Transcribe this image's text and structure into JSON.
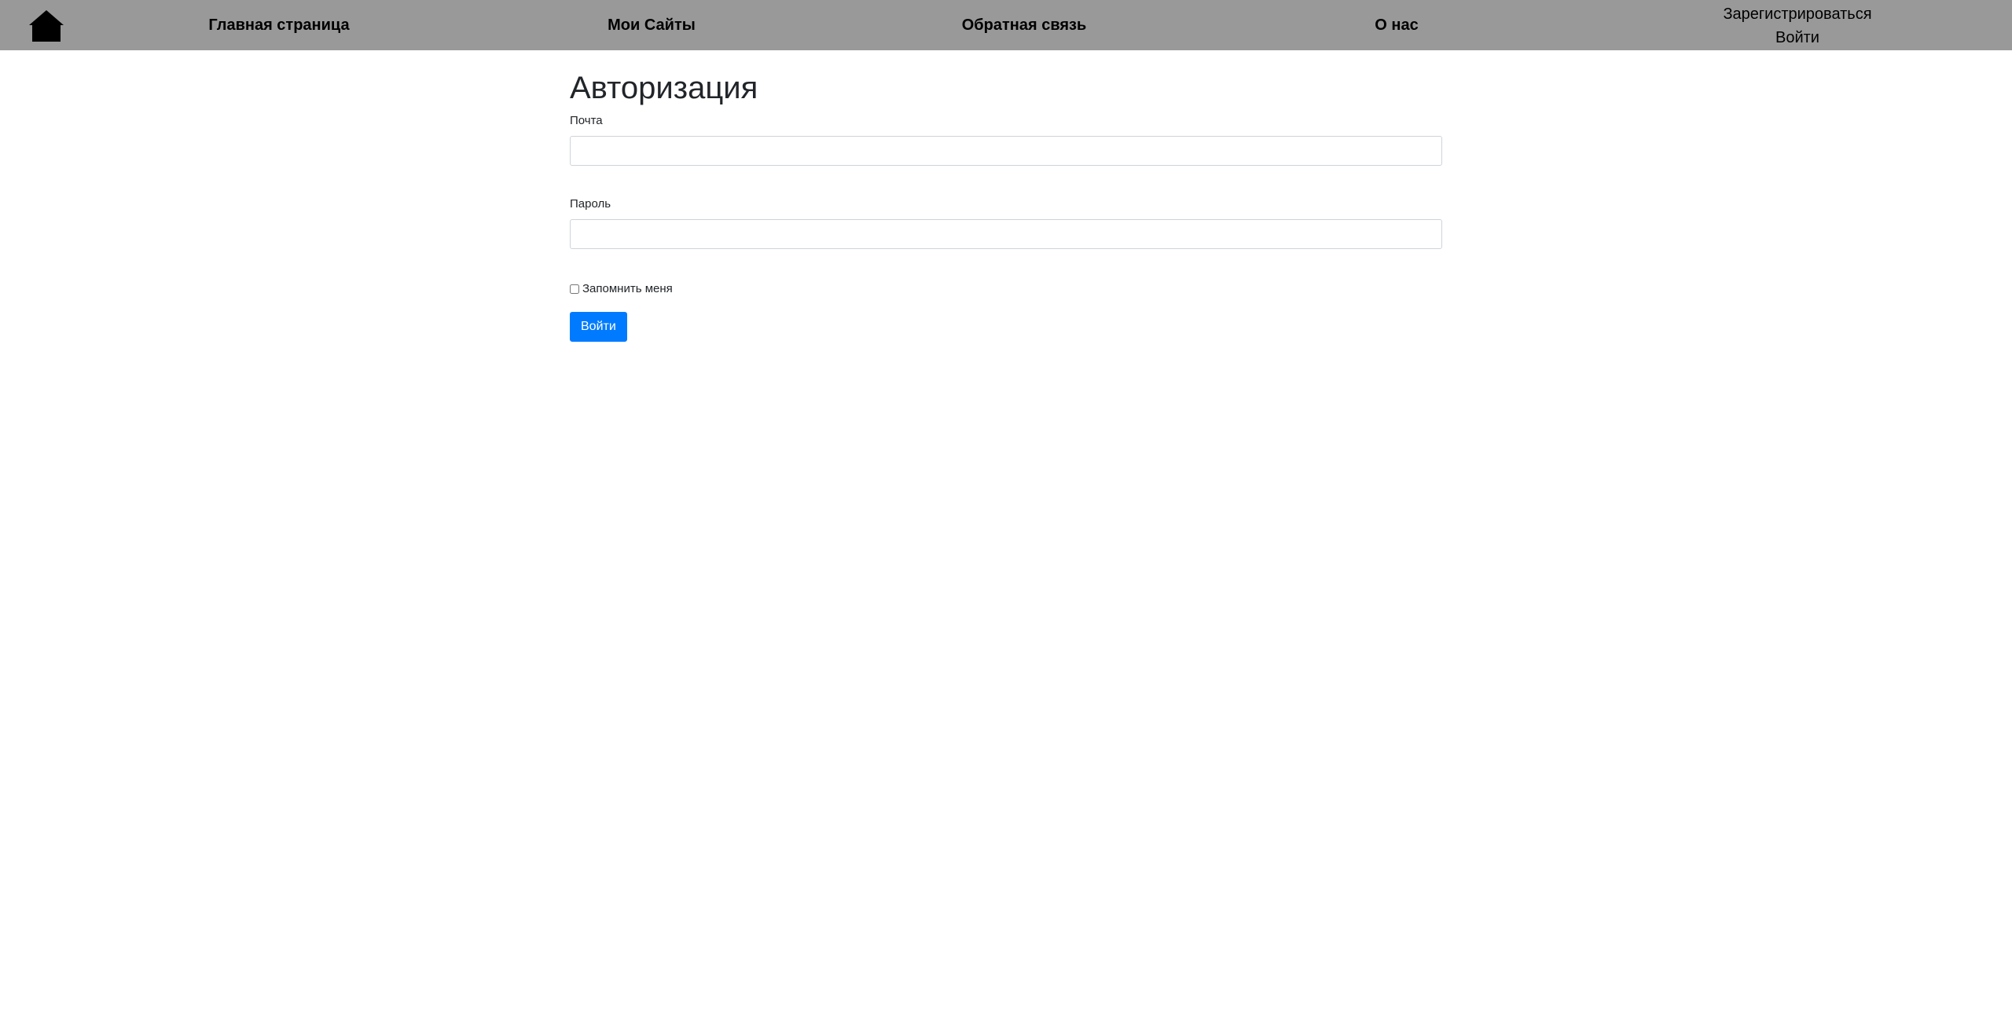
{
  "nav": {
    "home_icon": "house-icon",
    "items": [
      {
        "label": "Главная страница"
      },
      {
        "label": "Мои Сайты"
      },
      {
        "label": "Обратная связь"
      },
      {
        "label": "О нас"
      }
    ],
    "register": "Зарегистрироваться",
    "login": "Войти"
  },
  "form": {
    "title": "Авторизация",
    "email_label": "Почта",
    "email_value": "",
    "password_label": "Пароль",
    "password_value": "",
    "remember_label": "Запомнить меня",
    "remember_checked": false,
    "submit_label": "Войти"
  },
  "colors": {
    "topbar": "#999999",
    "primary": "#007bff"
  }
}
